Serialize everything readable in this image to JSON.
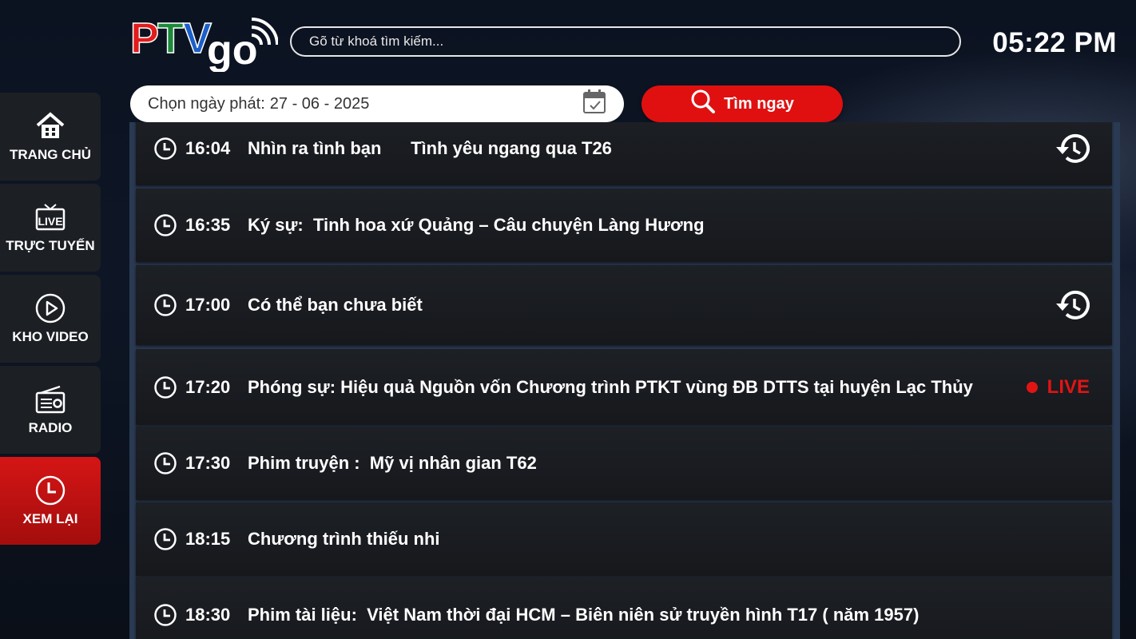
{
  "logo": {
    "text_ptv": "PTV",
    "text_go": "go",
    "colors": {
      "p": "#e21b1b",
      "t": "#1b8a3a",
      "v": "#1b5fc8"
    }
  },
  "header": {
    "search_placeholder": "Gõ từ khoá tìm kiếm...",
    "time": "05:22 PM"
  },
  "filter": {
    "date_label": "Chọn ngày phát:",
    "date_value": "27 - 06 - 2025",
    "search_button": "Tìm ngay"
  },
  "sidebar": {
    "items": [
      {
        "label": "TRANG CHỦ",
        "icon": "home-icon",
        "active": false
      },
      {
        "label": "TRỰC TUYẾN",
        "icon": "live-tv-icon",
        "active": false
      },
      {
        "label": "KHO VIDEO",
        "icon": "play-circle-icon",
        "active": false
      },
      {
        "label": "RADIO",
        "icon": "radio-icon",
        "active": false
      },
      {
        "label": "XEM LẠI",
        "icon": "clock-icon",
        "active": true
      }
    ]
  },
  "schedule": [
    {
      "time": "16:04",
      "title": "Nhìn ra tình bạn      Tình yêu ngang qua T26",
      "status": "replay"
    },
    {
      "time": "16:35",
      "title": "Ký sự:  Tinh hoa xứ Quảng – Câu chuyện Làng Hương",
      "status": ""
    },
    {
      "time": "17:00",
      "title": "Có thể bạn chưa biết",
      "status": "replay"
    },
    {
      "time": "17:20",
      "title": "Phóng sự: Hiệu quả Nguồn vốn Chương trình PTKT vùng ĐB DTTS tại huyện Lạc Thủy",
      "status": "live",
      "live_label": "LIVE"
    },
    {
      "time": "17:30",
      "title": "Phim truyện :  Mỹ vị nhân gian T62",
      "status": ""
    },
    {
      "time": "18:15",
      "title": "Chương trình thiếu nhi",
      "status": ""
    },
    {
      "time": "18:30",
      "title": "Phim tài liệu:  Việt Nam thời đại HCM – Biên niên sử truyền hình T17 ( năm 1957)",
      "status": ""
    }
  ],
  "colors": {
    "accent": "#e01010",
    "row_bg": "#1b1e23"
  }
}
